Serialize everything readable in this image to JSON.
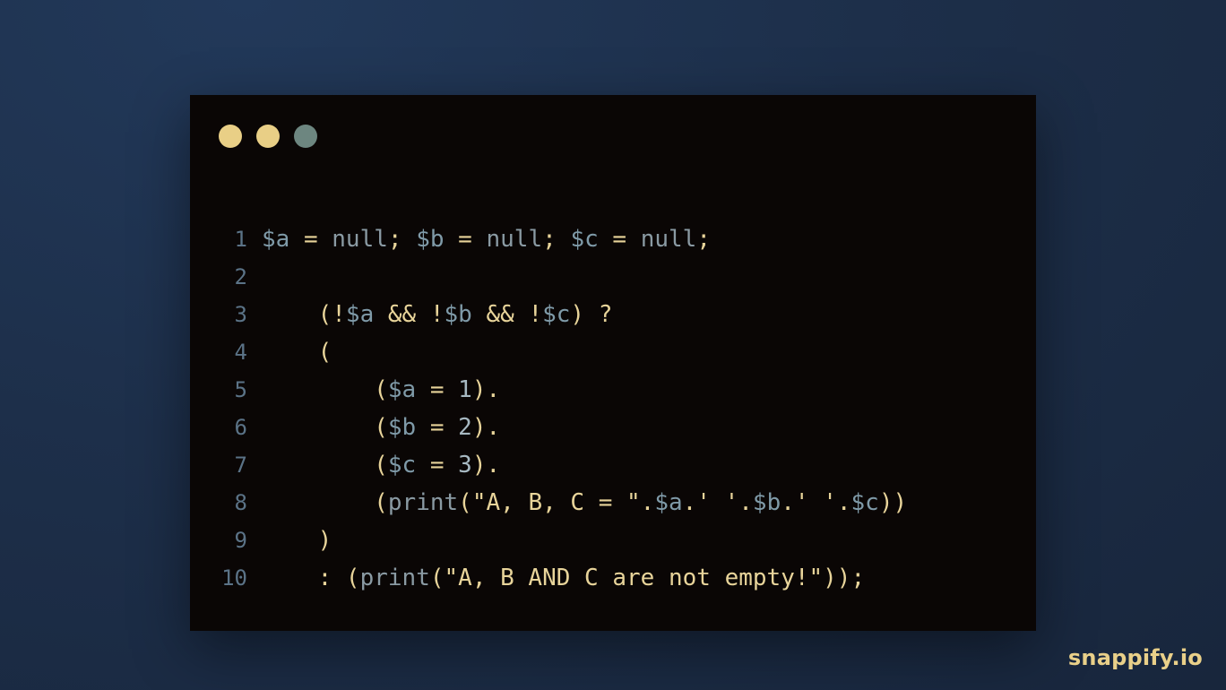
{
  "window": {
    "dots": [
      {
        "name": "dot-1",
        "color": "#e9cf86"
      },
      {
        "name": "dot-2",
        "color": "#e9cf86"
      },
      {
        "name": "dot-3",
        "color": "#6d8680"
      }
    ]
  },
  "code": {
    "lines": [
      {
        "number": "1",
        "tokens": [
          {
            "t": "$a",
            "c": "var"
          },
          {
            "t": " = ",
            "c": "punc"
          },
          {
            "t": "null",
            "c": "kw"
          },
          {
            "t": "; ",
            "c": "punc"
          },
          {
            "t": "$b",
            "c": "var"
          },
          {
            "t": " = ",
            "c": "punc"
          },
          {
            "t": "null",
            "c": "kw"
          },
          {
            "t": "; ",
            "c": "punc"
          },
          {
            "t": "$c",
            "c": "var"
          },
          {
            "t": " = ",
            "c": "punc"
          },
          {
            "t": "null",
            "c": "kw"
          },
          {
            "t": ";",
            "c": "punc"
          }
        ]
      },
      {
        "number": "2",
        "tokens": []
      },
      {
        "number": "3",
        "tokens": [
          {
            "t": "    (!",
            "c": "punc"
          },
          {
            "t": "$a",
            "c": "var"
          },
          {
            "t": " && !",
            "c": "punc"
          },
          {
            "t": "$b",
            "c": "var"
          },
          {
            "t": " && !",
            "c": "punc"
          },
          {
            "t": "$c",
            "c": "var"
          },
          {
            "t": ") ?",
            "c": "punc"
          }
        ]
      },
      {
        "number": "4",
        "tokens": [
          {
            "t": "    (",
            "c": "punc"
          }
        ]
      },
      {
        "number": "5",
        "tokens": [
          {
            "t": "        (",
            "c": "punc"
          },
          {
            "t": "$a",
            "c": "var"
          },
          {
            "t": " = ",
            "c": "punc"
          },
          {
            "t": "1",
            "c": "num"
          },
          {
            "t": ").",
            "c": "punc"
          }
        ]
      },
      {
        "number": "6",
        "tokens": [
          {
            "t": "        (",
            "c": "punc"
          },
          {
            "t": "$b",
            "c": "var"
          },
          {
            "t": " = ",
            "c": "punc"
          },
          {
            "t": "2",
            "c": "num"
          },
          {
            "t": ").",
            "c": "punc"
          }
        ]
      },
      {
        "number": "7",
        "tokens": [
          {
            "t": "        (",
            "c": "punc"
          },
          {
            "t": "$c",
            "c": "var"
          },
          {
            "t": " = ",
            "c": "punc"
          },
          {
            "t": "3",
            "c": "num"
          },
          {
            "t": ").",
            "c": "punc"
          }
        ]
      },
      {
        "number": "8",
        "tokens": [
          {
            "t": "        (",
            "c": "punc"
          },
          {
            "t": "print",
            "c": "kw"
          },
          {
            "t": "(\"A, B, C = \".",
            "c": "str"
          },
          {
            "t": "$a",
            "c": "var"
          },
          {
            "t": ".' '.",
            "c": "str"
          },
          {
            "t": "$b",
            "c": "var"
          },
          {
            "t": ".' '.",
            "c": "str"
          },
          {
            "t": "$c",
            "c": "var"
          },
          {
            "t": "))",
            "c": "punc"
          }
        ]
      },
      {
        "number": "9",
        "tokens": [
          {
            "t": "    )",
            "c": "punc"
          }
        ]
      },
      {
        "number": "10",
        "tokens": [
          {
            "t": "    : (",
            "c": "punc"
          },
          {
            "t": "print",
            "c": "kw"
          },
          {
            "t": "(\"A, B AND C are not empty!\"));",
            "c": "str"
          }
        ]
      }
    ]
  },
  "brand": {
    "label": "snappify.io"
  }
}
